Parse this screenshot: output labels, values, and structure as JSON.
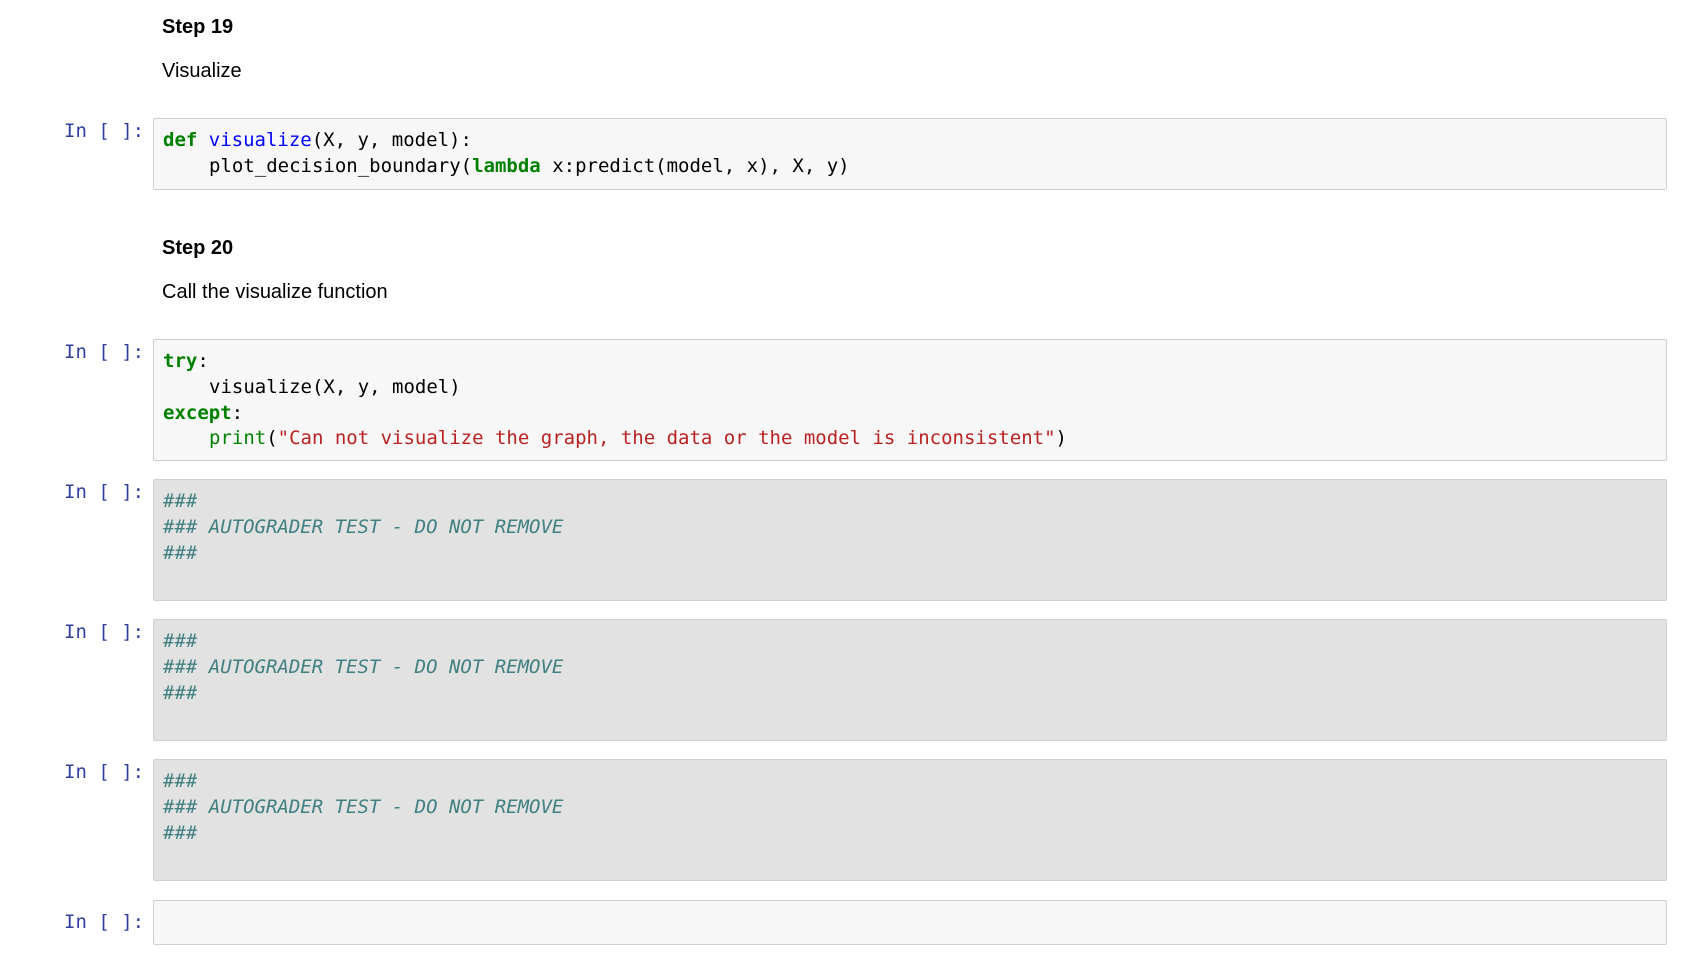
{
  "step19": {
    "heading": "Step 19",
    "text": "Visualize"
  },
  "step20": {
    "heading": "Step 20",
    "text": "Call the visualize function"
  },
  "prompt_label": "In [ ]:",
  "cell1": {
    "def_kw": "def",
    "fn_name": "visualize",
    "fn_args": "(X, y, model):",
    "call_start": "plot_decision_boundary(",
    "lambda_kw": "lambda",
    "call_rest": " x:predict(model, x), X, y)"
  },
  "cell2": {
    "try_kw": "try",
    "colon": ":",
    "visualize_call": "visualize(X, y, model)",
    "except_kw": "except",
    "print_fn": "print",
    "open_paren": "(",
    "message": "\"Can not visualize the graph, the data or the model is inconsistent\"",
    "close_paren": ")"
  },
  "autograder": {
    "hashes": "###",
    "title": "### AUTOGRADER TEST - DO NOT REMOVE"
  },
  "colors": {
    "prompt": "#303f9f",
    "keyword": "#008000",
    "function": "#0000ff",
    "string": "#ba2121",
    "comment": "#408080",
    "cell_bg": "#f7f7f7",
    "readonly_bg": "#e2e2e2"
  }
}
